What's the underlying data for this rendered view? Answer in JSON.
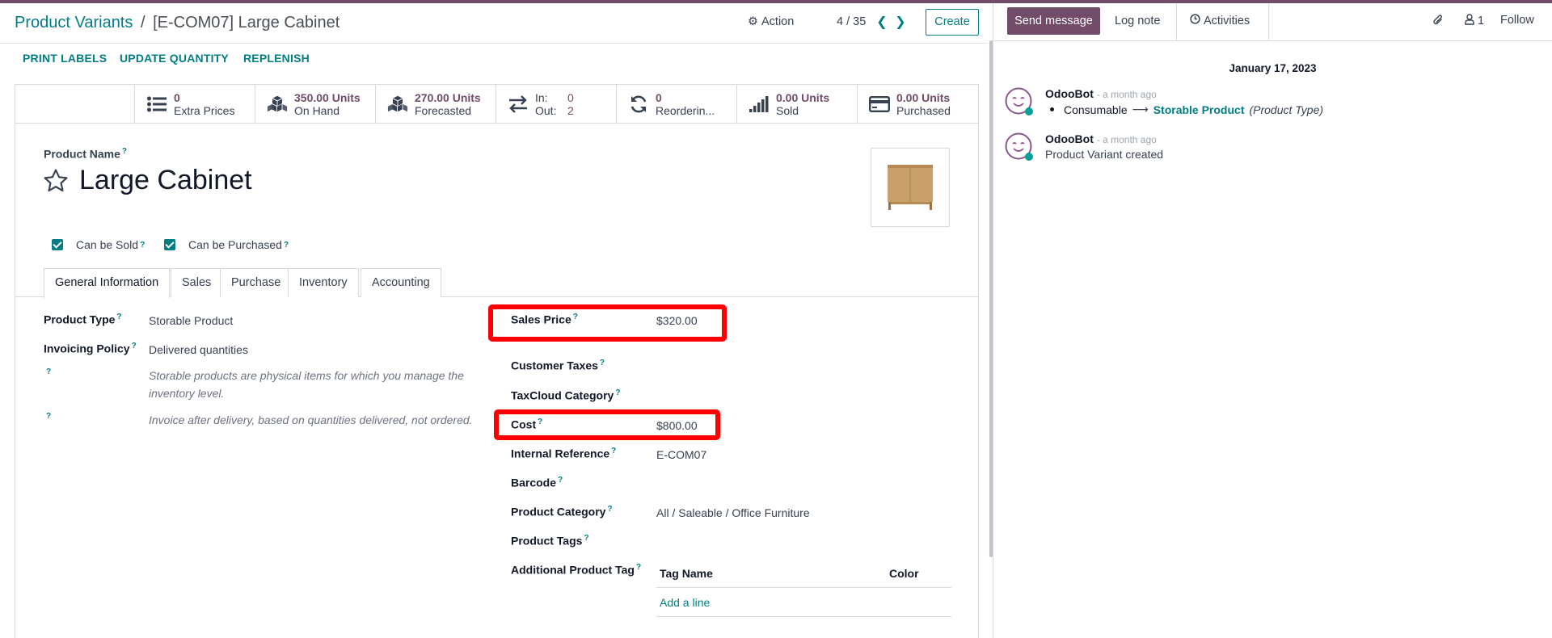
{
  "breadcrumb": {
    "parent": "Product Variants",
    "separator": "/",
    "current": "[E-COM07] Large Cabinet"
  },
  "control_panel": {
    "action_label": "Action",
    "pager": "4 / 35",
    "create_label": "Create"
  },
  "action_buttons": [
    "PRINT LABELS",
    "UPDATE QUANTITY",
    "REPLENISH"
  ],
  "stats": {
    "extra_prices": {
      "value": "0",
      "label": "Extra Prices"
    },
    "on_hand": {
      "value": "350.00 Units",
      "label": "On Hand"
    },
    "forecasted": {
      "value": "270.00 Units",
      "label": "Forecasted"
    },
    "in_out": {
      "in_label": "In:",
      "in_value": "0",
      "out_label": "Out:",
      "out_value": "2"
    },
    "reordering": {
      "value": "0",
      "label": "Reorderin..."
    },
    "sold": {
      "value": "0.00 Units",
      "label": "Sold"
    },
    "purchased": {
      "value": "0.00 Units",
      "label": "Purchased"
    }
  },
  "product": {
    "name_label": "Product Name",
    "name": "Large Cabinet",
    "can_be_sold": "Can be Sold",
    "can_be_purchased": "Can be Purchased"
  },
  "help_mark": "?",
  "tabs": [
    "General Information",
    "Sales",
    "Purchase",
    "Inventory",
    "Accounting"
  ],
  "left_fields": {
    "product_type_label": "Product Type",
    "product_type": "Storable Product",
    "invoicing_policy_label": "Invoicing Policy",
    "invoicing_policy": "Delivered quantities",
    "help_1": "Storable products are physical items for which you manage the inventory level.",
    "help_2": "Invoice after delivery, based on quantities delivered, not ordered."
  },
  "right_fields": {
    "sales_price_label": "Sales Price",
    "sales_price": "$320.00",
    "customer_taxes_label": "Customer Taxes",
    "taxcloud_label": "TaxCloud Category",
    "cost_label": "Cost",
    "cost": "$800.00",
    "internal_ref_label": "Internal Reference",
    "internal_ref": "E-COM07",
    "barcode_label": "Barcode",
    "category_label": "Product Category",
    "category": "All / Saleable / Office Furniture",
    "tags_label": "Product Tags",
    "additional_tag_label": "Additional Product Tag",
    "tag_table": {
      "col_name": "Tag Name",
      "col_color": "Color",
      "add_line": "Add a line"
    }
  },
  "chatter": {
    "send_message": "Send message",
    "log_note": "Log note",
    "activities": "Activities",
    "followers_count": "1",
    "follow": "Follow",
    "date": "January 17, 2023",
    "messages": [
      {
        "author": "OdooBot",
        "ago": "- a month ago",
        "old_value": "Consumable",
        "new_value": "Storable Product",
        "field": "(Product Type)"
      },
      {
        "author": "OdooBot",
        "ago": "- a month ago",
        "body": "Product Variant created"
      }
    ]
  },
  "colors": {
    "brand": "#714b67",
    "accent": "#017e84",
    "highlight": "#ff0000"
  }
}
